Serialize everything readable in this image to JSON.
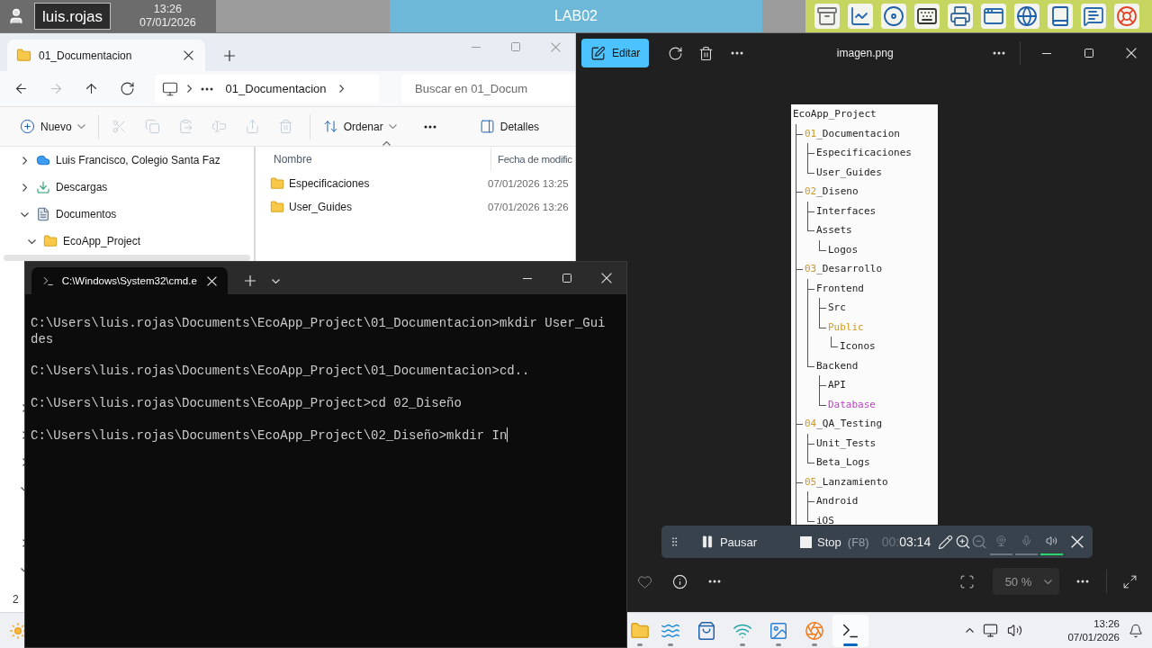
{
  "top_bar": {
    "user": "luis.rojas",
    "time": "13:26",
    "date": "07/01/2026",
    "lab": "LAB02"
  },
  "explorer": {
    "tab": {
      "title": "01_Documentacion"
    },
    "nav": [
      {
        "kind": "back",
        "disabled": false
      },
      {
        "kind": "forward",
        "disabled": true
      },
      {
        "kind": "up",
        "disabled": false
      },
      {
        "kind": "refresh",
        "disabled": false
      }
    ],
    "breadcrumb": {
      "current": "01_Documentacion"
    },
    "search": {
      "placeholder": "Buscar en 01_Docum"
    },
    "commands": [
      {
        "kind": "new",
        "label": "Nuevo",
        "disabled": false
      },
      {
        "kind": "cut",
        "disabled": true
      },
      {
        "kind": "copy",
        "disabled": true
      },
      {
        "kind": "paste",
        "disabled": true
      },
      {
        "kind": "rename",
        "disabled": true
      },
      {
        "kind": "share",
        "disabled": true
      },
      {
        "kind": "delete",
        "disabled": true
      },
      {
        "kind": "sort",
        "label": "Ordenar",
        "disabled": false
      },
      {
        "kind": "more",
        "disabled": false
      }
    ],
    "details": {
      "label": "Detalles"
    },
    "sidebar": {
      "items": [
        {
          "kind": "cloud",
          "label": "Luis Francisco, Colegio Santa Faz",
          "expanded": false,
          "selected": false
        },
        {
          "kind": "download",
          "label": "Descargas",
          "expanded": false,
          "selected": false
        },
        {
          "kind": "documents",
          "label": "Documentos",
          "expanded": true,
          "selected": false,
          "children": [
            {
              "kind": "folder",
              "label": "EcoApp_Project",
              "expanded": true,
              "selected": false,
              "children": [
                {
                  "selected": true
                }
              ]
            }
          ]
        }
      ],
      "lower_items": [
        {
          "expanded": false
        },
        {
          "expanded": false
        },
        {
          "expanded": false
        },
        {
          "expanded": true
        },
        {
          "expanded": false
        },
        {
          "expanded": true
        }
      ]
    },
    "columns": [
      "Nombre",
      "Fecha de modific"
    ],
    "rows": [
      {
        "name": "Especificaciones",
        "date": "07/01/2026 13:25"
      },
      {
        "name": "User_Guides",
        "date": "07/01/2026 13:26"
      }
    ],
    "status_bar": "2"
  },
  "terminal": {
    "tab": "C:\\Windows\\System32\\cmd.e",
    "lines": [
      "C:\\Users\\luis.rojas\\Documents\\EcoApp_Project\\01_Documentacion>mkdir User_Guides",
      "C:\\Users\\luis.rojas\\Documents\\EcoApp_Project\\01_Documentacion>cd..",
      "C:\\Users\\luis.rojas\\Documents\\EcoApp_Project>cd 02_Diseño",
      "C:\\Users\\luis.rojas\\Documents\\EcoApp_Project\\02_Diseño>mkdir In"
    ]
  },
  "photos": {
    "edit_label": "Editar",
    "title": "imagen.png",
    "zoom": "50 %",
    "tree": {
      "name": "EcoApp_Project",
      "children": [
        {
          "prefix": "01",
          "name": "_Documentacion",
          "children": [
            {
              "name": "Especificaciones"
            },
            {
              "name": "User_Guides"
            }
          ]
        },
        {
          "prefix": "02",
          "name": "_Diseno",
          "children": [
            {
              "name": "Interfaces"
            },
            {
              "name": "Assets",
              "children": [
                {
                  "name": "Logos"
                }
              ]
            }
          ]
        },
        {
          "prefix": "03",
          "name": "_Desarrollo",
          "children": [
            {
              "name": "Frontend",
              "children": [
                {
                  "name": "Src"
                },
                {
                  "name": "Public",
                  "color": "#d39a1c",
                  "children": [
                    {
                      "name": "Iconos"
                    }
                  ]
                }
              ]
            },
            {
              "name": "Backend",
              "children": [
                {
                  "name": "API"
                },
                {
                  "name": "Database",
                  "color": "#c040c8"
                }
              ]
            }
          ]
        },
        {
          "prefix": "04",
          "name": "_QA_Testing",
          "children": [
            {
              "name": "Unit_Tests"
            },
            {
              "name": "Beta_Logs"
            }
          ]
        },
        {
          "prefix": "05",
          "name": "_Lanzamiento",
          "children": [
            {
              "name": "Android"
            },
            {
              "name": "iOS"
            }
          ]
        }
      ]
    }
  },
  "recorder": {
    "pause": "Pausar",
    "stop": "Stop",
    "shortcut": "(F8)",
    "timer_dim": "00:",
    "timer": "03:14",
    "toggles": [
      {
        "kind": "webcam",
        "on": false
      },
      {
        "kind": "mic",
        "on": false
      },
      {
        "kind": "speaker",
        "on": true
      }
    ]
  },
  "taskbar": {
    "items": [
      {
        "kind": "folder",
        "running": true,
        "selected": false
      },
      {
        "kind": "edge",
        "running": true,
        "selected": false
      },
      {
        "kind": "store",
        "running": false,
        "selected": false
      },
      {
        "kind": "app",
        "running": true,
        "selected": false
      },
      {
        "kind": "photos",
        "running": true,
        "selected": false
      },
      {
        "kind": "recorder",
        "running": true,
        "selected": false
      },
      {
        "kind": "terminal",
        "running": true,
        "selected": true
      }
    ],
    "time": "13:26",
    "date": "07/01/2026"
  }
}
